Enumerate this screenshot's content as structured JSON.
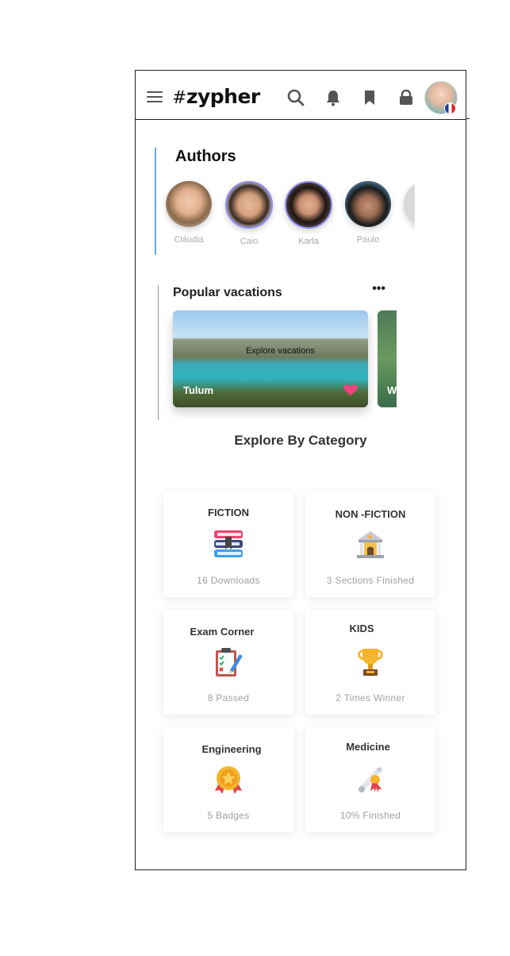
{
  "header": {
    "logo_hash": "#",
    "logo_text": "zypher",
    "icons": [
      "search-icon",
      "bell-icon",
      "bookmark-icon",
      "lock-icon"
    ],
    "accent_color": "#5fa8e6"
  },
  "authors": {
    "title": "Authors",
    "items": [
      {
        "name": "Cláudia"
      },
      {
        "name": "Caio"
      },
      {
        "name": "Karla"
      },
      {
        "name": "Paulo"
      }
    ]
  },
  "vacations": {
    "title": "Popular vacations",
    "more": "•••",
    "overlay_text": "Explore vacations",
    "cards": [
      {
        "place": "Tulum",
        "favorite": true
      },
      {
        "place": "W"
      }
    ]
  },
  "explore": {
    "title": "Explore By Category",
    "categories": [
      {
        "title": "FICTION",
        "subtitle": "16 Downloads",
        "icon": "books-icon"
      },
      {
        "title": "NON -FICTION",
        "subtitle": "3 Sections Finished",
        "icon": "museum-icon"
      },
      {
        "title": "Exam Corner",
        "subtitle": "8 Passed",
        "icon": "clipboard-icon"
      },
      {
        "title": "KIDS",
        "subtitle": "2 Times Winner",
        "icon": "trophy-icon"
      },
      {
        "title": "Engineering",
        "subtitle": "5 Badges",
        "icon": "medal-icon"
      },
      {
        "title": "Medicine",
        "subtitle": "10% Finished",
        "icon": "diploma-icon"
      }
    ]
  }
}
